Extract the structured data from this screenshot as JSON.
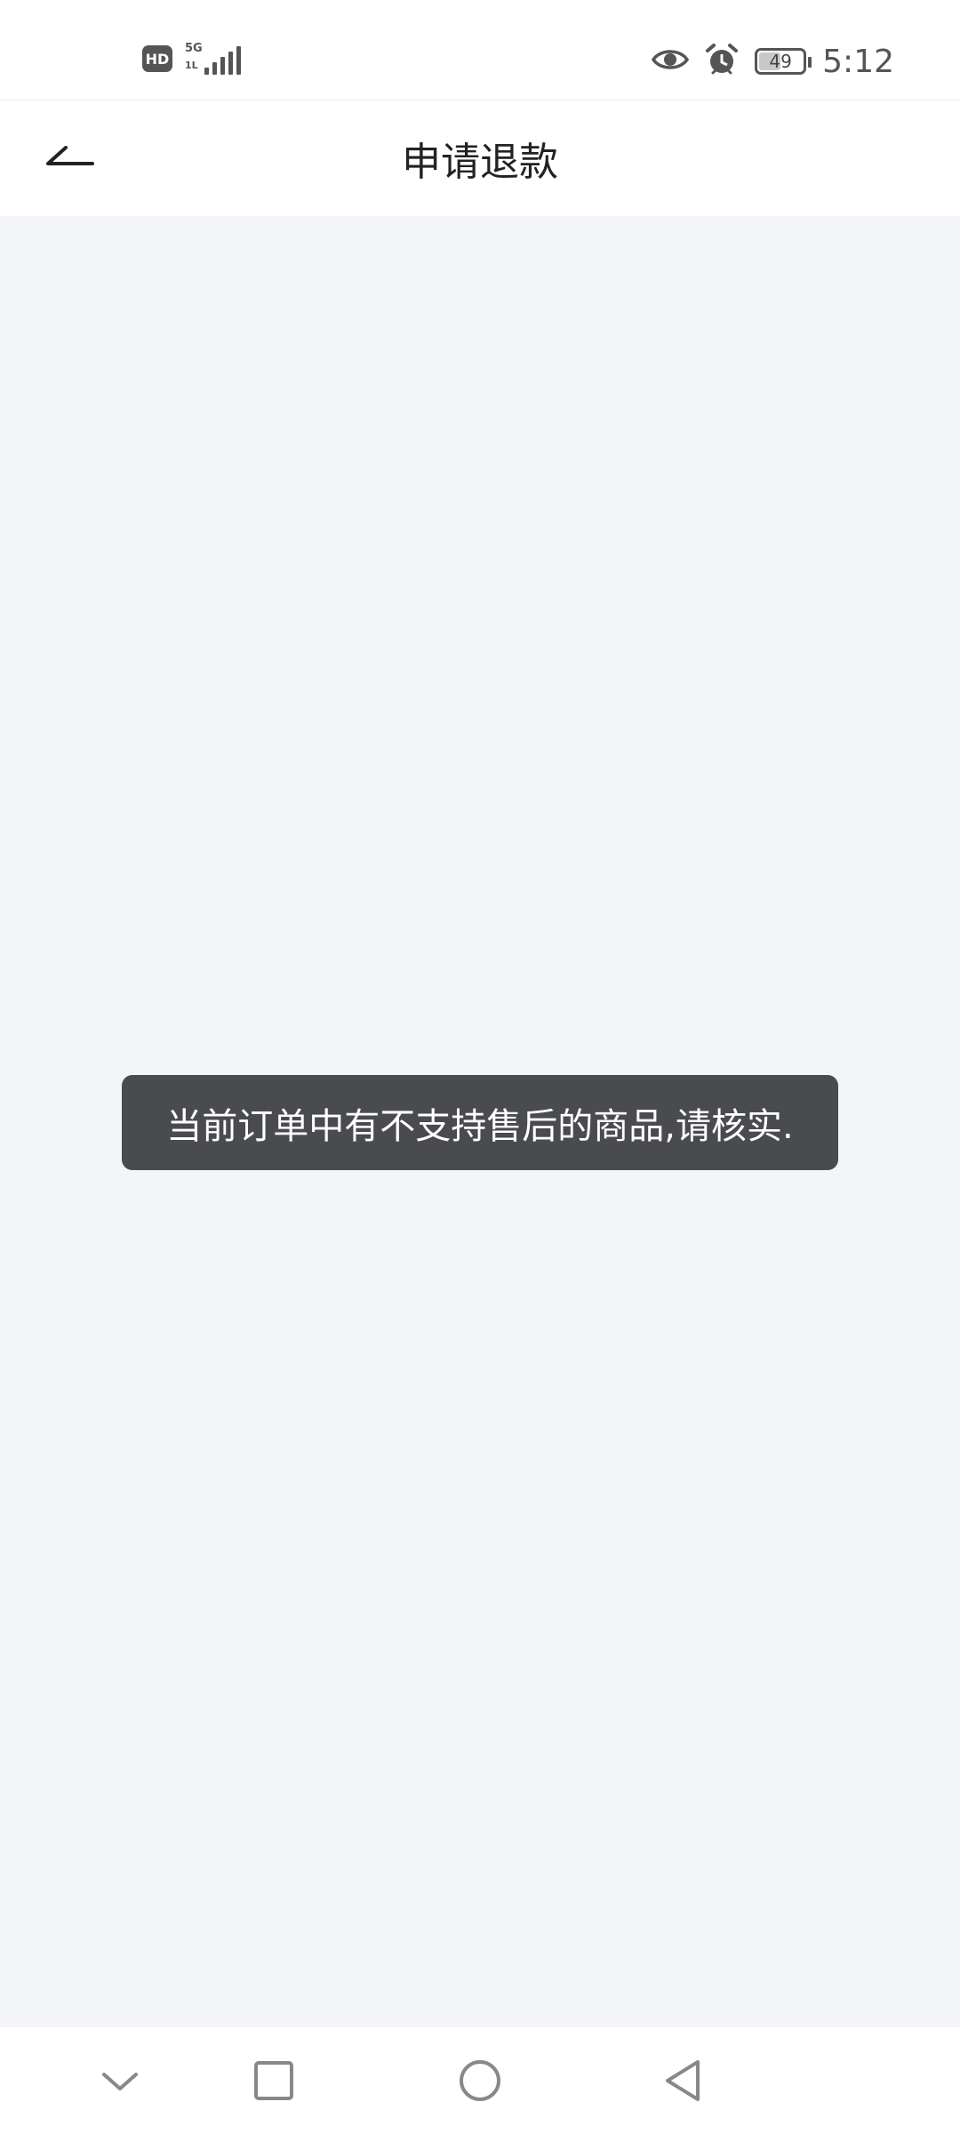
{
  "status_bar": {
    "hd_label": "HD",
    "network_label": "5G",
    "network_sub": "1L",
    "battery_level": "49",
    "time": "5:12",
    "icons": [
      "hd-icon",
      "signal-icon",
      "eye-icon",
      "alarm-icon",
      "battery-icon"
    ]
  },
  "app_bar": {
    "title": "申请退款",
    "back_icon": "back-arrow-icon"
  },
  "toast": {
    "message": "当前订单中有不支持售后的商品,请核实."
  },
  "nav_bar": {
    "icons": [
      "chevron-down-icon",
      "recents-square-icon",
      "home-circle-icon",
      "back-triangle-icon"
    ]
  },
  "colors": {
    "page_background": "#f4f5f9",
    "toast_background": "#4a4b4f",
    "bar_background": "#ffffff",
    "icon_gray": "#555555"
  }
}
